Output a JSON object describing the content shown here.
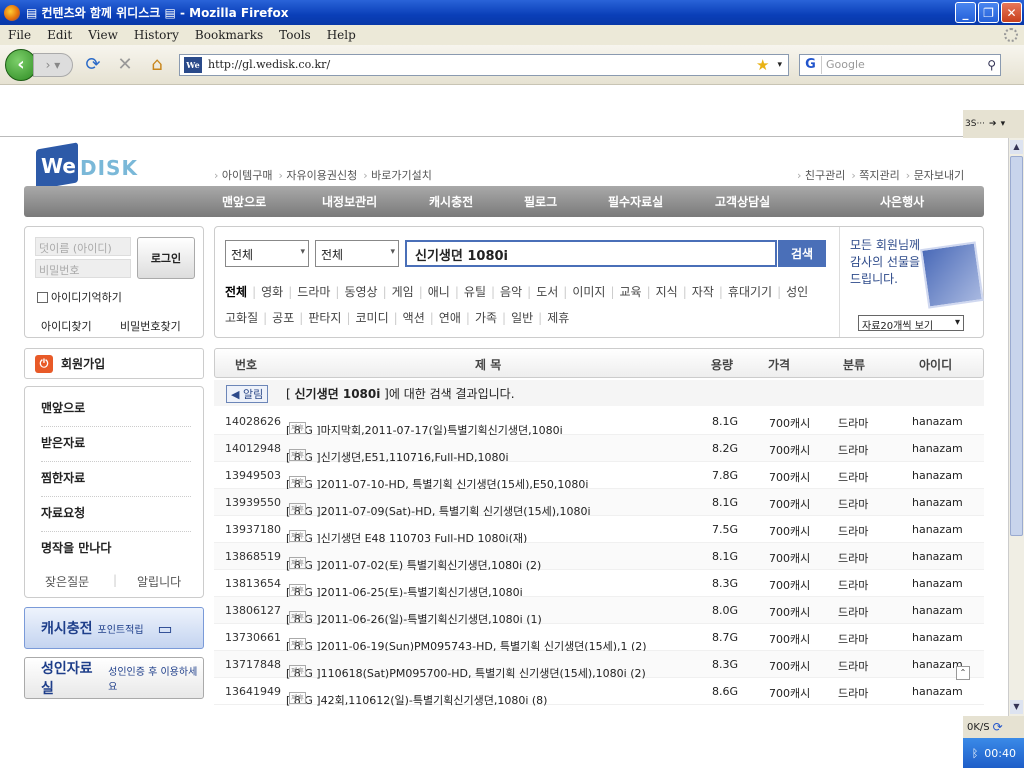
{
  "window": {
    "title": "▤ 컨텐츠와 함께 위디스크 ▤ - Mozilla Firefox"
  },
  "menu": [
    "File",
    "Edit",
    "View",
    "History",
    "Bookmarks",
    "Tools",
    "Help"
  ],
  "browser": {
    "url": "http://gl.wedisk.co.kr/",
    "search_placeholder": "Google",
    "bm_overflow": "3S···"
  },
  "site": {
    "logo_we": "We",
    "logo_disk": "DISK",
    "top_links_left": [
      "아이템구매",
      "자유이용권신청",
      "바로가기설치"
    ],
    "top_links_right": [
      "친구관리",
      "쪽지관리",
      "문자보내기"
    ],
    "nav": [
      "맨앞으로",
      "내정보관리",
      "캐시충전",
      "필로그",
      "필수자료실",
      "고객상담실",
      "사은행사"
    ]
  },
  "login": {
    "id_placeholder": "덧이름 (아이디)",
    "pw_placeholder": "비밀번호",
    "login_btn": "로그인",
    "remember": "아이디기억하기",
    "find_id": "아이디찾기",
    "find_pw": "비밀번호찾기"
  },
  "search": {
    "select1": "전체",
    "select2": "전체",
    "query": "신기생뎐 1080i",
    "button": "검색",
    "categories1": [
      "전체",
      "영화",
      "드라마",
      "동영상",
      "게임",
      "애니",
      "유틸",
      "음악",
      "도서",
      "이미지",
      "교육",
      "지식",
      "자작",
      "휴대기기",
      "성인"
    ],
    "categories2": [
      "고화질",
      "공포",
      "판타지",
      "코미디",
      "액션",
      "연애",
      "가족",
      "일반",
      "제휴"
    ]
  },
  "ad": {
    "line1": "모든 회원님께",
    "line2": "감사의 선물을",
    "line3": "드립니다.",
    "dropdown": "자료20개씩 보기"
  },
  "sidebar": {
    "join": "회원가입",
    "items": [
      "맨앞으로",
      "받은자료",
      "찜한자료",
      "자료요청",
      "명작을 만나다"
    ],
    "faq": "잦은질문",
    "notice": "알립니다",
    "cash_btn": "캐시충전",
    "cash_sub": "포인트적립",
    "adult_btn": "성인자료실",
    "adult_sub": "성인인증 후 이용하세요"
  },
  "table": {
    "headers": [
      "번호",
      "제 목",
      "용량",
      "가격",
      "분류",
      "아이디"
    ],
    "notice_tag": "알림",
    "notice_prefix": "[ ",
    "notice_query": "신기생뎐 1080i",
    "notice_suffix": " ]에 대한 검색 결과입니다.",
    "badge": "제휴",
    "rows": [
      {
        "id": "14028626",
        "title": "[ 8 G ]마지막회,2011-07-17(일)특별기획신기생뎐,1080i",
        "size": "8.1G",
        "price": "700캐시",
        "cat": "드라마",
        "user": "hanazam"
      },
      {
        "id": "14012948",
        "title": "[ 8 G ]신기생뎐,E51,110716,Full-HD,1080i",
        "size": "8.2G",
        "price": "700캐시",
        "cat": "드라마",
        "user": "hanazam"
      },
      {
        "id": "13949503",
        "title": "[ 8 G ]2011-07-10-HD, 특별기획 신기생뎐(15세),E50,1080i",
        "size": "7.8G",
        "price": "700캐시",
        "cat": "드라마",
        "user": "hanazam"
      },
      {
        "id": "13939550",
        "title": "[ 8 G ]2011-07-09(Sat)-HD, 특별기획 신기생뎐(15세),1080i",
        "size": "8.1G",
        "price": "700캐시",
        "cat": "드라마",
        "user": "hanazam"
      },
      {
        "id": "13937180",
        "title": "[ 8 G ]신기생뎐 E48 110703 Full-HD 1080i(재)",
        "size": "7.5G",
        "price": "700캐시",
        "cat": "드라마",
        "user": "hanazam"
      },
      {
        "id": "13868519",
        "title": "[ 8 G ]2011-07-02(토) 특별기획신기생뎐,1080i (2)",
        "size": "8.1G",
        "price": "700캐시",
        "cat": "드라마",
        "user": "hanazam"
      },
      {
        "id": "13813654",
        "title": "[ 8 G ]2011-06-25(토)-특별기획신기생뎐,1080i",
        "size": "8.3G",
        "price": "700캐시",
        "cat": "드라마",
        "user": "hanazam"
      },
      {
        "id": "13806127",
        "title": "[ 8 G ]2011-06-26(일)-특별기획신기생뎐,1080i (1)",
        "size": "8.0G",
        "price": "700캐시",
        "cat": "드라마",
        "user": "hanazam"
      },
      {
        "id": "13730661",
        "title": "[ 8 G ]2011-06-19(Sun)PM095743-HD, 특별기획 신기생뎐(15세),1 (2)",
        "size": "8.7G",
        "price": "700캐시",
        "cat": "드라마",
        "user": "hanazam"
      },
      {
        "id": "13717848",
        "title": "[ 8 G ]110618(Sat)PM095700-HD, 특별기획 신기생뎐(15세),1080i (2)",
        "size": "8.3G",
        "price": "700캐시",
        "cat": "드라마",
        "user": "hanazam"
      },
      {
        "id": "13641949",
        "title": "[ 8 G ]42회,110612(일)-특별기획신기생뎐,1080i (8)",
        "size": "8.6G",
        "price": "700캐시",
        "cat": "드라마",
        "user": "hanazam"
      }
    ]
  },
  "status": {
    "speed": "0K/S",
    "clock": "00:40"
  }
}
